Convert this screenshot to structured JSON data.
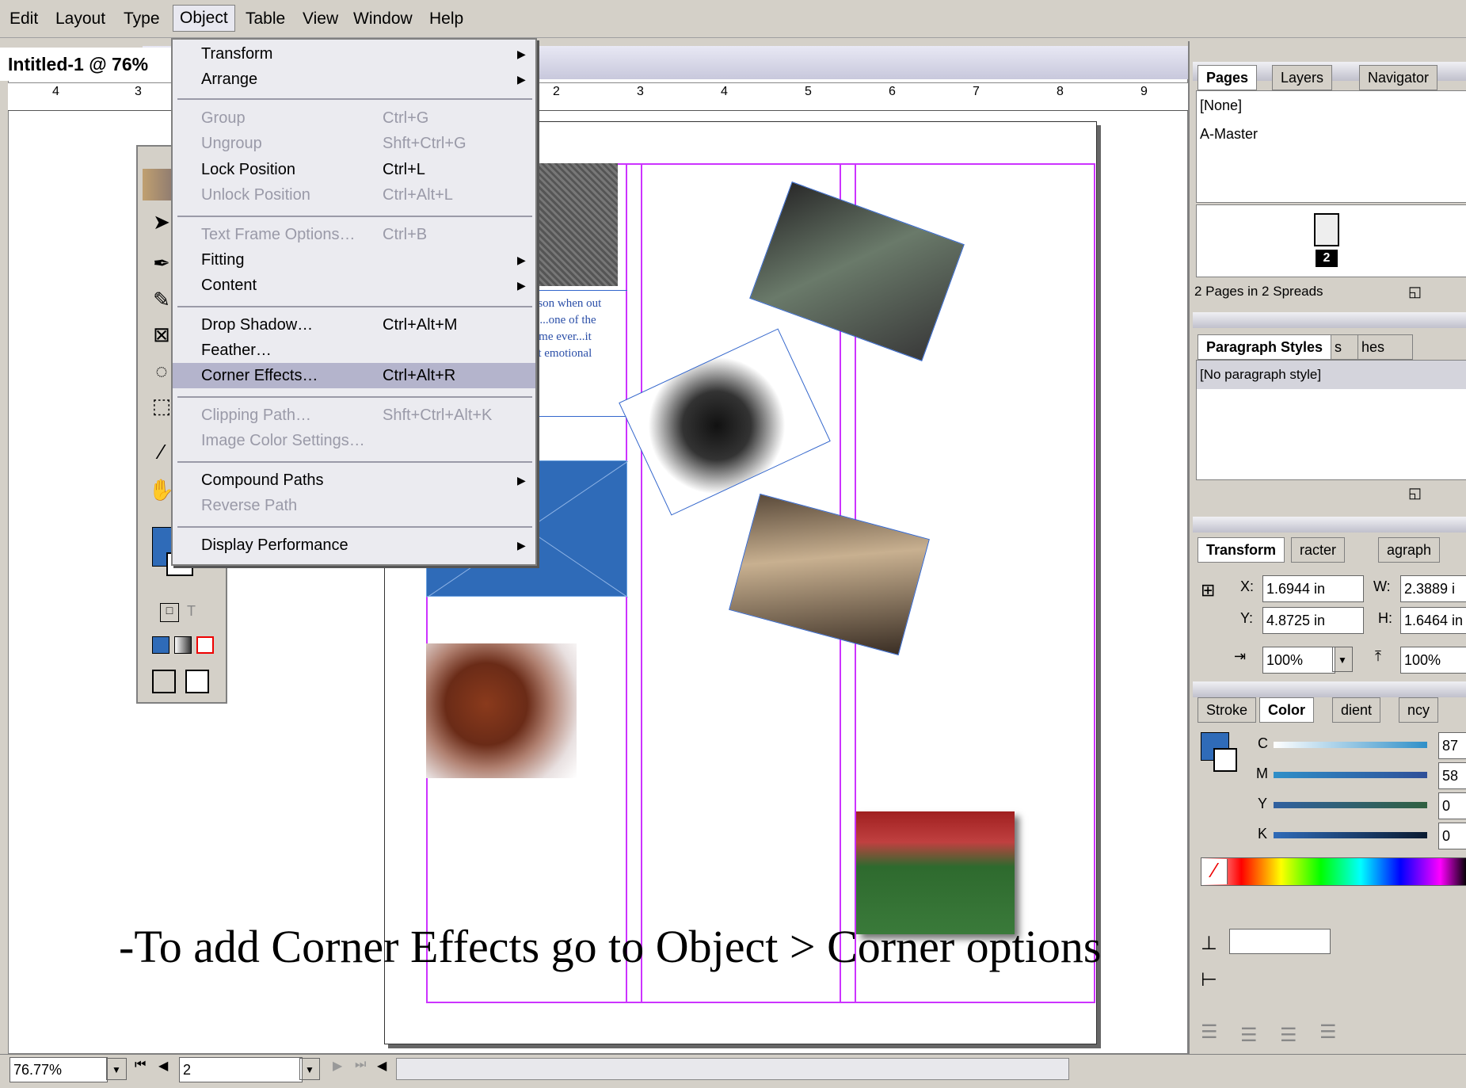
{
  "menubar": {
    "items": [
      "Edit",
      "Layout",
      "Type",
      "Object",
      "Table",
      "View",
      "Window",
      "Help"
    ],
    "active": "Object"
  },
  "document": {
    "title": "Intitled-1 @ 76%",
    "ruler_ticks": [
      "4",
      "3",
      "2",
      "3",
      "4",
      "5",
      "6",
      "7",
      "8",
      "9"
    ]
  },
  "object_menu": {
    "items": [
      {
        "label": "Transform",
        "shortcut": "",
        "submenu": true,
        "enabled": true
      },
      {
        "label": "Arrange",
        "shortcut": "",
        "submenu": true,
        "enabled": true
      },
      {
        "label": "Group",
        "shortcut": "Ctrl+G",
        "submenu": false,
        "enabled": false
      },
      {
        "label": "Ungroup",
        "shortcut": "Shft+Ctrl+G",
        "submenu": false,
        "enabled": false
      },
      {
        "label": "Lock Position",
        "shortcut": "Ctrl+L",
        "submenu": false,
        "enabled": true
      },
      {
        "label": "Unlock Position",
        "shortcut": "Ctrl+Alt+L",
        "submenu": false,
        "enabled": false
      },
      {
        "label": "Text Frame Options…",
        "shortcut": "Ctrl+B",
        "submenu": false,
        "enabled": false
      },
      {
        "label": "Fitting",
        "shortcut": "",
        "submenu": true,
        "enabled": true
      },
      {
        "label": "Content",
        "shortcut": "",
        "submenu": true,
        "enabled": true
      },
      {
        "label": "Drop Shadow…",
        "shortcut": "Ctrl+Alt+M",
        "submenu": false,
        "enabled": true
      },
      {
        "label": "Feather…",
        "shortcut": "",
        "submenu": false,
        "enabled": true
      },
      {
        "label": "Corner Effects…",
        "shortcut": "Ctrl+Alt+R",
        "submenu": false,
        "enabled": true,
        "highlighted": true
      },
      {
        "label": "Clipping Path…",
        "shortcut": "Shft+Ctrl+Alt+K",
        "submenu": false,
        "enabled": false
      },
      {
        "label": "Image Color Settings…",
        "shortcut": "",
        "submenu": false,
        "enabled": false
      },
      {
        "label": "Compound Paths",
        "shortcut": "",
        "submenu": true,
        "enabled": true
      },
      {
        "label": "Reverse Path",
        "shortcut": "",
        "submenu": false,
        "enabled": false
      },
      {
        "label": "Display Performance",
        "shortcut": "",
        "submenu": true,
        "enabled": true
      }
    ]
  },
  "page_text": {
    "line1": "eason when out",
    "line2": "ht....one of the",
    "line3": "game ever...it",
    "line4": "ost emotional"
  },
  "pages_panel": {
    "tabs": [
      "Pages",
      "Layers",
      "Navigator"
    ],
    "none": "[None]",
    "master": "A-Master",
    "page_num": "2",
    "summary": "2 Pages in 2 Spreads"
  },
  "para_panel": {
    "tabs": [
      "Paragraph Styles",
      "s",
      "hes"
    ],
    "item": "[No paragraph style]"
  },
  "transform_panel": {
    "tabs": [
      "Transform",
      "racter",
      "agraph"
    ],
    "x_label": "X:",
    "x": "1.6944 in",
    "y_label": "Y:",
    "y": "4.8725 in",
    "w_label": "W:",
    "w": "2.3889 i",
    "h_label": "H:",
    "h": "1.6464 in",
    "scale_x": "100%",
    "scale_y": "100%"
  },
  "color_panel": {
    "tabs": [
      "Stroke",
      "Color",
      "dient",
      "ncy"
    ],
    "c_label": "C",
    "c": "87",
    "m_label": "M",
    "m": "58",
    "y_label": "Y",
    "y": "0",
    "k_label": "K",
    "k": "0",
    "fill_color": "#2f6bb8"
  },
  "status": {
    "zoom": "76.77%",
    "page": "2"
  },
  "caption": "-To add Corner Effects go to Object > Corner options",
  "colors": {
    "accent": "#2f6bb8",
    "margin_guides": "#cc33ff",
    "menu_highlight": "#b4b4cc"
  }
}
